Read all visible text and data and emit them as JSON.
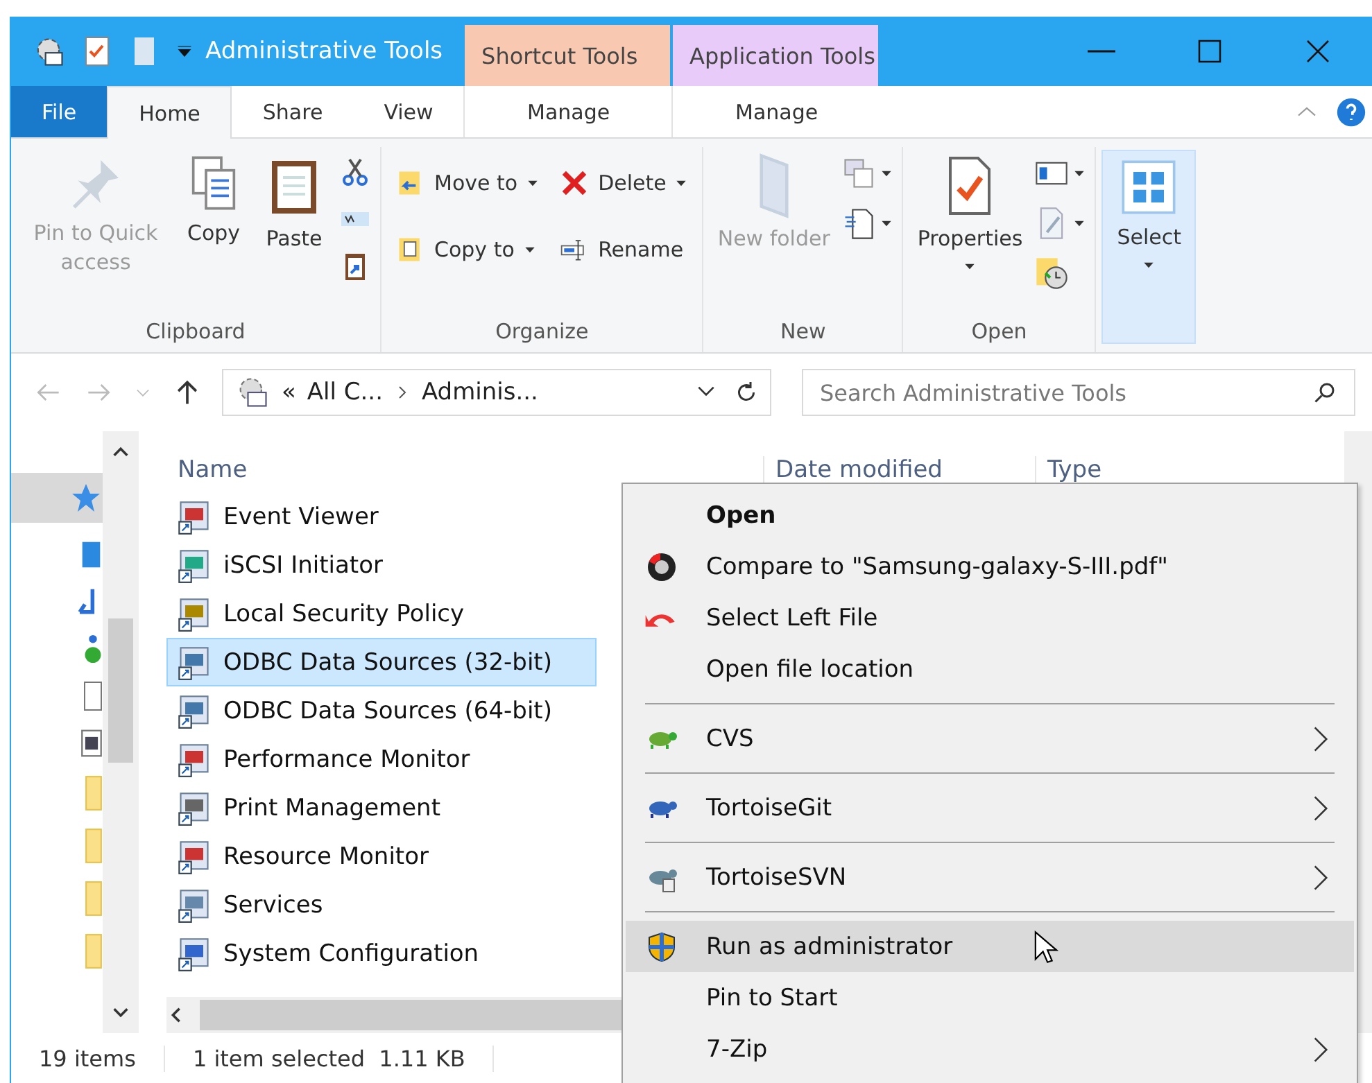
{
  "window": {
    "title": "Administrative Tools",
    "contextual_groups": [
      {
        "label": "Shortcut Tools",
        "color": "#f8c8b0"
      },
      {
        "label": "Application Tools",
        "color": "#e8cbf8"
      }
    ]
  },
  "ribbon_tabs": [
    {
      "label": "File",
      "kind": "file",
      "selected": false
    },
    {
      "label": "Home",
      "kind": "normal",
      "selected": true
    },
    {
      "label": "Share",
      "kind": "normal",
      "selected": false
    },
    {
      "label": "View",
      "kind": "normal",
      "selected": false
    },
    {
      "label": "Manage",
      "kind": "contextual",
      "selected": false
    },
    {
      "label": "Manage",
      "kind": "contextual",
      "selected": false
    }
  ],
  "ribbon_groups": [
    {
      "label": "Clipboard",
      "buttons": [
        {
          "label": "Pin to Quick access",
          "kind": "large",
          "disabled": true,
          "dropdown": false
        },
        {
          "label": "Copy",
          "kind": "large",
          "disabled": false,
          "dropdown": false
        },
        {
          "label": "Paste",
          "kind": "large",
          "disabled": false,
          "dropdown": false
        }
      ]
    },
    {
      "label": "Organize",
      "buttons": [
        {
          "label": "Move to",
          "kind": "small",
          "dropdown": true
        },
        {
          "label": "Delete",
          "kind": "small",
          "dropdown": true
        },
        {
          "label": "Copy to",
          "kind": "small",
          "dropdown": true
        },
        {
          "label": "Rename",
          "kind": "small",
          "dropdown": false
        }
      ]
    },
    {
      "label": "New",
      "buttons": [
        {
          "label": "New folder",
          "kind": "large",
          "disabled": true,
          "dropdown": false
        }
      ]
    },
    {
      "label": "Open",
      "buttons": [
        {
          "label": "Properties",
          "kind": "large",
          "disabled": false,
          "dropdown": true
        }
      ]
    },
    {
      "highlighted": true,
      "buttons": [
        {
          "label": "Select",
          "kind": "large",
          "disabled": false,
          "dropdown": true
        }
      ]
    }
  ],
  "address": {
    "overflow": "«",
    "crumbs": [
      "All C...",
      "Adminis..."
    ],
    "search_placeholder": "Search Administrative Tools"
  },
  "columns": [
    "Name",
    "Date modified",
    "Type"
  ],
  "files": [
    {
      "name": "Event Viewer",
      "selected": false
    },
    {
      "name": "iSCSI Initiator",
      "selected": false
    },
    {
      "name": "Local Security Policy",
      "selected": false
    },
    {
      "name": "ODBC Data Sources (32-bit)",
      "selected": true
    },
    {
      "name": "ODBC Data Sources (64-bit)",
      "selected": false
    },
    {
      "name": "Performance Monitor",
      "selected": false
    },
    {
      "name": "Print Management",
      "selected": false
    },
    {
      "name": "Resource Monitor",
      "selected": false
    },
    {
      "name": "Services",
      "selected": false
    },
    {
      "name": "System Configuration",
      "selected": false
    }
  ],
  "status_bar": {
    "count": "19 items",
    "selection": "1 item selected  1.11 KB"
  },
  "context_menu": [
    {
      "kind": "item",
      "label": "Open",
      "bold": true,
      "submenu": false,
      "selected": false
    },
    {
      "kind": "item",
      "label": "Compare to \"Samsung-galaxy-S-III.pdf\"",
      "bold": false,
      "submenu": false,
      "selected": false
    },
    {
      "kind": "item",
      "label": "Select Left File",
      "bold": false,
      "submenu": false,
      "selected": false
    },
    {
      "kind": "item",
      "label": "Open file location",
      "bold": false,
      "submenu": false,
      "selected": false
    },
    {
      "kind": "separator"
    },
    {
      "kind": "item",
      "label": "CVS",
      "bold": false,
      "submenu": true,
      "selected": false
    },
    {
      "kind": "separator"
    },
    {
      "kind": "item",
      "label": "TortoiseGit",
      "bold": false,
      "submenu": true,
      "selected": false
    },
    {
      "kind": "separator"
    },
    {
      "kind": "item",
      "label": "TortoiseSVN",
      "bold": false,
      "submenu": true,
      "selected": false
    },
    {
      "kind": "separator"
    },
    {
      "kind": "item",
      "label": "Run as administrator",
      "bold": false,
      "submenu": false,
      "selected": true
    },
    {
      "kind": "item",
      "label": "Pin to Start",
      "bold": false,
      "submenu": false,
      "selected": false
    },
    {
      "kind": "item",
      "label": "7-Zip",
      "bold": false,
      "submenu": true,
      "selected": false
    }
  ]
}
